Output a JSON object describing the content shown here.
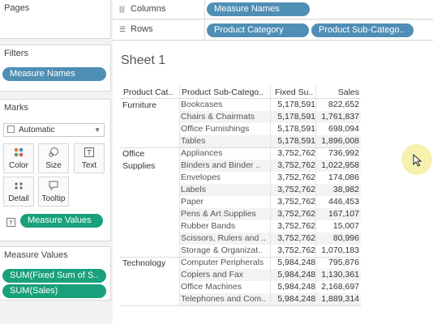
{
  "pages": {
    "title": "Pages"
  },
  "filters": {
    "title": "Filters",
    "pill": "Measure Names"
  },
  "marks": {
    "title": "Marks",
    "type_value": "Automatic",
    "buttons": [
      {
        "label": "Color",
        "icon": "color-dots-icon"
      },
      {
        "label": "Size",
        "icon": "size-icon"
      },
      {
        "label": "Text",
        "icon": "text-icon"
      },
      {
        "label": "Detail",
        "icon": "detail-icon"
      },
      {
        "label": "Tooltip",
        "icon": "tooltip-icon"
      }
    ],
    "text_pill": "Measure Values"
  },
  "measure_values": {
    "title": "Measure Values",
    "pills": [
      "SUM(Fixed Sum of S..",
      "SUM(Sales)"
    ]
  },
  "shelves": {
    "columns_label": "Columns",
    "rows_label": "Rows",
    "columns_pills": [
      "Measure Names"
    ],
    "rows_pills": [
      "Product Category",
      "Product Sub-Catego.."
    ]
  },
  "sheet": {
    "title": "Sheet 1"
  },
  "table": {
    "headers": [
      "Product Cat..",
      "Product Sub-Catego..",
      "Fixed Su..",
      "Sales"
    ],
    "groups": [
      {
        "category": "Furniture",
        "rows": [
          {
            "sub": "Bookcases",
            "fixed": "5,178,591",
            "sales": "822,652"
          },
          {
            "sub": "Chairs & Chairmats",
            "fixed": "5,178,591",
            "sales": "1,761,837"
          },
          {
            "sub": "Office Furnishings",
            "fixed": "5,178,591",
            "sales": "698,094"
          },
          {
            "sub": "Tables",
            "fixed": "5,178,591",
            "sales": "1,896,008"
          }
        ]
      },
      {
        "category": "Office Supplies",
        "rows": [
          {
            "sub": "Appliances",
            "fixed": "3,752,762",
            "sales": "736,992"
          },
          {
            "sub": "Binders and Binder ..",
            "fixed": "3,752,762",
            "sales": "1,022,958"
          },
          {
            "sub": "Envelopes",
            "fixed": "3,752,762",
            "sales": "174,086"
          },
          {
            "sub": "Labels",
            "fixed": "3,752,762",
            "sales": "38,982"
          },
          {
            "sub": "Paper",
            "fixed": "3,752,762",
            "sales": "446,453"
          },
          {
            "sub": "Pens & Art Supplies",
            "fixed": "3,752,762",
            "sales": "167,107"
          },
          {
            "sub": "Rubber Bands",
            "fixed": "3,752,762",
            "sales": "15,007"
          },
          {
            "sub": "Scissors, Rulers and ..",
            "fixed": "3,752,762",
            "sales": "80,996"
          },
          {
            "sub": "Storage & Organizat..",
            "fixed": "3,752,762",
            "sales": "1,070,183"
          }
        ]
      },
      {
        "category": "Technology",
        "rows": [
          {
            "sub": "Computer Peripherals",
            "fixed": "5,984,248",
            "sales": "795,876"
          },
          {
            "sub": "Copiers and Fax",
            "fixed": "5,984,248",
            "sales": "1,130,361"
          },
          {
            "sub": "Office Machines",
            "fixed": "5,984,248",
            "sales": "2,168,697"
          },
          {
            "sub": "Telephones and Com..",
            "fixed": "5,984,248",
            "sales": "1,889,314"
          }
        ]
      }
    ]
  },
  "colors": {
    "blue_pill": "#4f8eb5",
    "green_pill": "#18a17a",
    "band": "#f3f3f3"
  }
}
